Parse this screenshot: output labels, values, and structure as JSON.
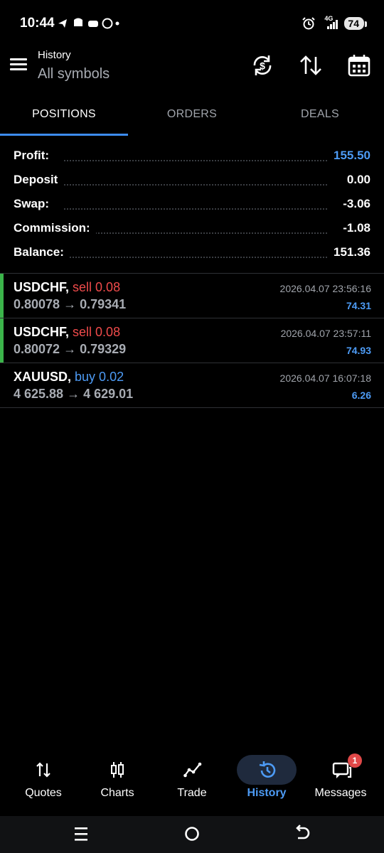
{
  "status_bar": {
    "time": "10:44",
    "network": "4G",
    "battery": "74"
  },
  "header": {
    "title": "History",
    "subtitle": "All symbols"
  },
  "tabs": [
    {
      "label": "POSITIONS",
      "active": true
    },
    {
      "label": "ORDERS",
      "active": false
    },
    {
      "label": "DEALS",
      "active": false
    }
  ],
  "summary": [
    {
      "label": "Profit:",
      "value": "155.50"
    },
    {
      "label": "Deposit",
      "value": "0.00"
    },
    {
      "label": "Swap:",
      "value": "-3.06"
    },
    {
      "label": "Commission:",
      "value": "-1.08"
    },
    {
      "label": "Balance:",
      "value": "151.36"
    }
  ],
  "positions": [
    {
      "symbol": "USDCHF,",
      "side": "sell 0.08",
      "prices": "0.80078 → 0.79341",
      "datetime": "2026.04.07 23:56:16",
      "profit": "74.31"
    },
    {
      "symbol": "USDCHF,",
      "side": "sell 0.08",
      "prices": "0.80072 → 0.79329",
      "datetime": "2026.04.07 23:57:11",
      "profit": "74.93"
    },
    {
      "symbol": "XAUUSD,",
      "side": "buy 0.02",
      "prices": "4 625.88 → 4 629.01",
      "datetime": "2026.04.07 16:07:18",
      "profit": "6.26"
    }
  ],
  "bottom_nav": [
    {
      "label": "Quotes",
      "icon": "quotes-arrows-icon"
    },
    {
      "label": "Charts",
      "icon": "candlestick-icon"
    },
    {
      "label": "Trade",
      "icon": "trade-line-icon"
    },
    {
      "label": "History",
      "icon": "history-clock-icon",
      "active": true
    },
    {
      "label": "Messages",
      "icon": "chat-icon",
      "badge": "1"
    }
  ],
  "colors": {
    "accent": "#3d8cf0",
    "sell": "#f04b4b",
    "buy": "#4d9bf5",
    "win_bar": "#3bb44a",
    "background": "#000000"
  }
}
